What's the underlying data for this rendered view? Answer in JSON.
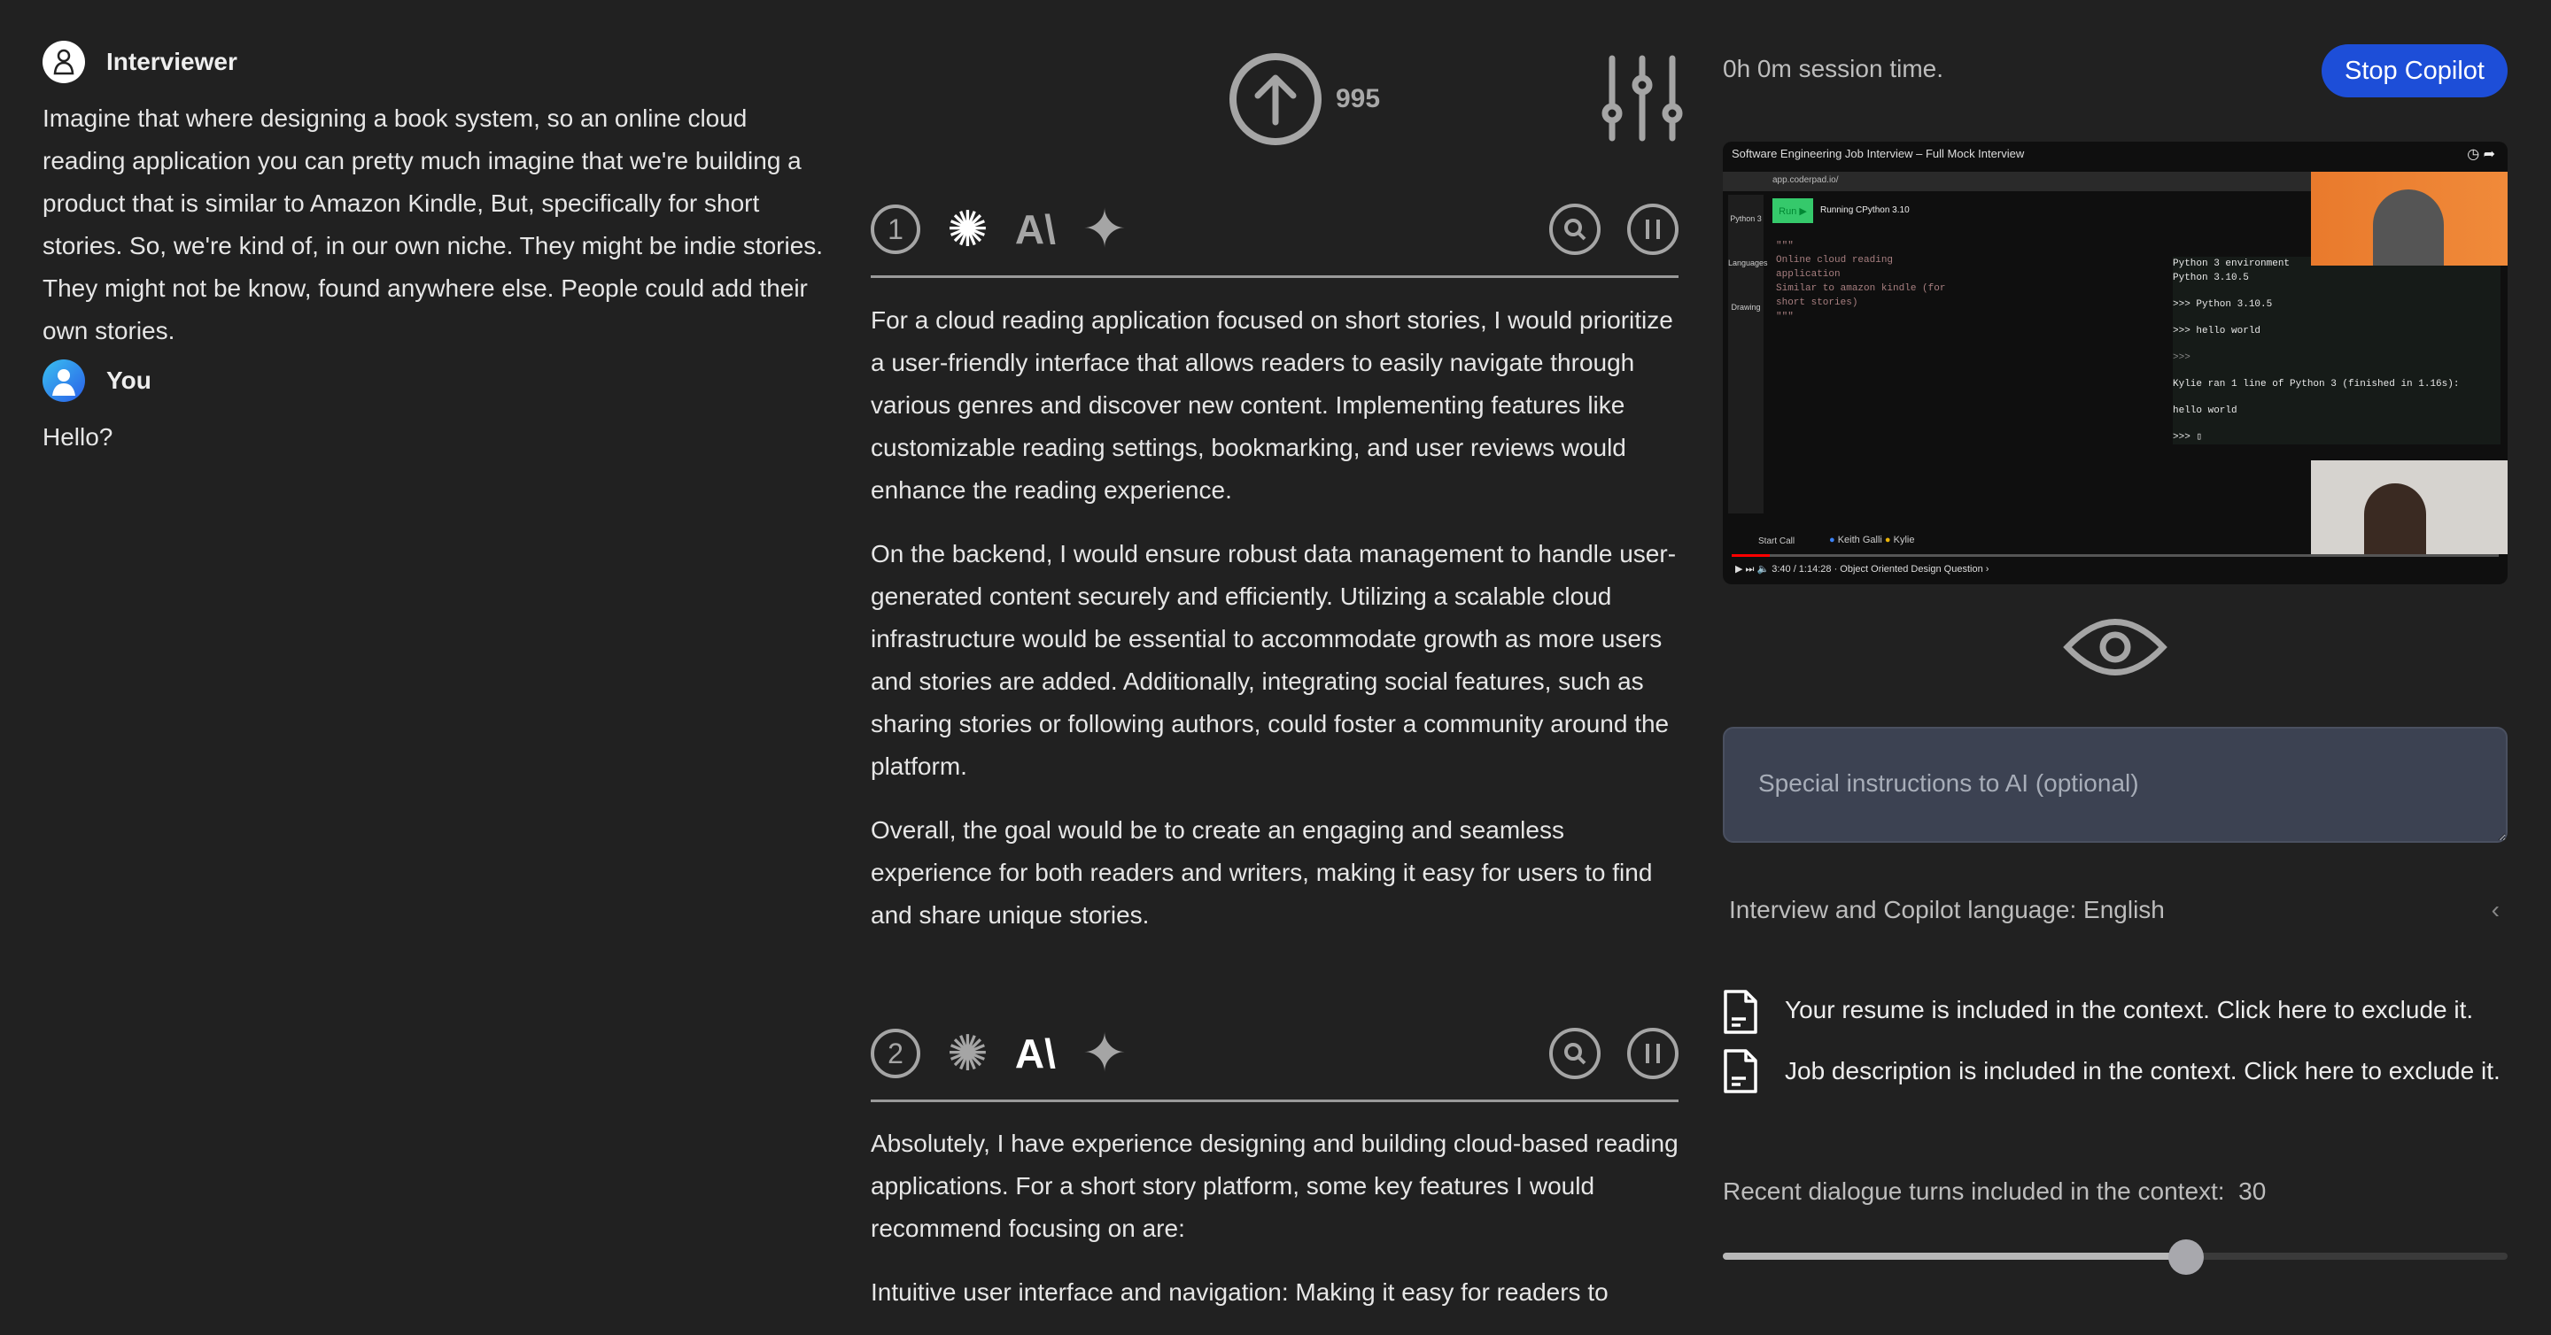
{
  "transcript": {
    "turns": [
      {
        "speaker": "Interviewer",
        "avatar": "person-outline-icon",
        "text": "Imagine that where designing a book system, so an online cloud reading application you can pretty much imagine that we're building a product that is similar to Amazon Kindle, But, specifically for short stories. So, we're kind of, in our own niche. They might be indie stories. They might not be know, found anywhere else. People could add their own stories."
      },
      {
        "speaker": "You",
        "avatar": "user-avatar-icon",
        "text": "Hello?"
      }
    ]
  },
  "toolbar": {
    "upload_count": "995",
    "upload_icon": "arrow-up-circle-icon",
    "settings_icon": "sliders-icon"
  },
  "answers": [
    {
      "number": "1",
      "active_model": "openai",
      "paragraphs": [
        "For a cloud reading application focused on short stories, I would prioritize a user-friendly interface that allows readers to easily navigate through various genres and discover new content. Implementing features like customizable reading settings, bookmarking, and user reviews would enhance the reading experience.",
        "On the backend, I would ensure robust data management to handle user-generated content securely and efficiently. Utilizing a scalable cloud infrastructure would be essential to accommodate growth as more users and stories are added. Additionally, integrating social features, such as sharing stories or following authors, could foster a community around the platform.",
        "Overall, the goal would be to create an engaging and seamless experience for both readers and writers, making it easy for users to find and share unique stories."
      ]
    },
    {
      "number": "2",
      "active_model": "anthropic",
      "paragraphs": [
        "Absolutely, I have experience designing and building cloud-based reading applications. For a short story platform, some key features I would recommend focusing on are:",
        "Intuitive user interface and navigation: Making it easy for readers to"
      ]
    }
  ],
  "session": {
    "time_text": "0h 0m session time.",
    "stop_label": "Stop Copilot",
    "accent": "#1d4ed8"
  },
  "video": {
    "title": "Software Engineering Job Interview – Full Mock Interview",
    "url": "app.coderpad.io/",
    "language": "Python 3",
    "run_label": "Run ▶",
    "running": "Running CPython 3.10",
    "sidebar": [
      "Languages",
      "Drawing"
    ],
    "code_lines": [
      "\"\"\"",
      "Online cloud reading application",
      "Similar to amazon kindle (for short stories)",
      "\"\"\""
    ],
    "console": [
      "Python 3 environment",
      "Python 3.10.5",
      ">>> Python 3.10.5",
      ">>> hello world",
      ">>>",
      "Kylie ran 1 line of Python 3 (finished in 1.16s):",
      "hello world",
      ">>> ▯"
    ],
    "call_label": "Start Call",
    "participants": [
      "Keith Galli",
      "Kylie"
    ],
    "time": "3:40 / 1:14:28 · Object Oriented Design Question ›"
  },
  "instructions": {
    "placeholder": "Special instructions to AI (optional)"
  },
  "language": {
    "label": "Interview and Copilot language: English"
  },
  "context": {
    "resume": "Your resume is included in the context. Click here to exclude it.",
    "job": "Job description is included in the context. Click here to exclude it.",
    "turns_label": "Recent dialogue turns included in the context:",
    "turns_value": "30",
    "turns_slider_fraction": 0.59
  }
}
